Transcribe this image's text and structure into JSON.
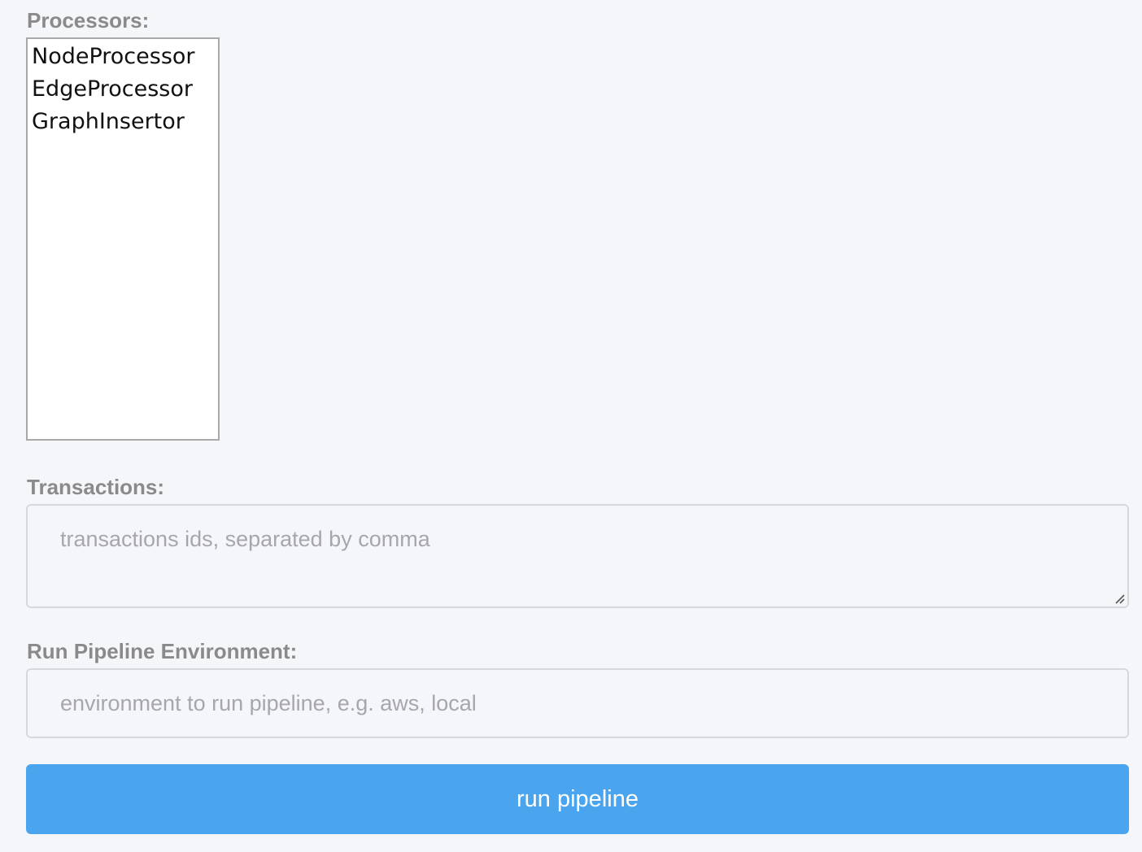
{
  "processors": {
    "label": "Processors:",
    "options": [
      "NodeProcessor",
      "EdgeProcessor",
      "GraphInsertor"
    ]
  },
  "transactions": {
    "label": "Transactions:",
    "placeholder": "transactions ids, separated by comma",
    "value": ""
  },
  "environment": {
    "label": "Run Pipeline Environment:",
    "placeholder": "environment to run pipeline, e.g. aws, local",
    "value": ""
  },
  "run_button": {
    "label": "run pipeline"
  },
  "colors": {
    "background": "#f5f6fa",
    "label_text": "#8a8a8a",
    "placeholder_text": "#a7a7ab",
    "button_bg": "#4aa5ee",
    "button_text": "#ffffff"
  }
}
